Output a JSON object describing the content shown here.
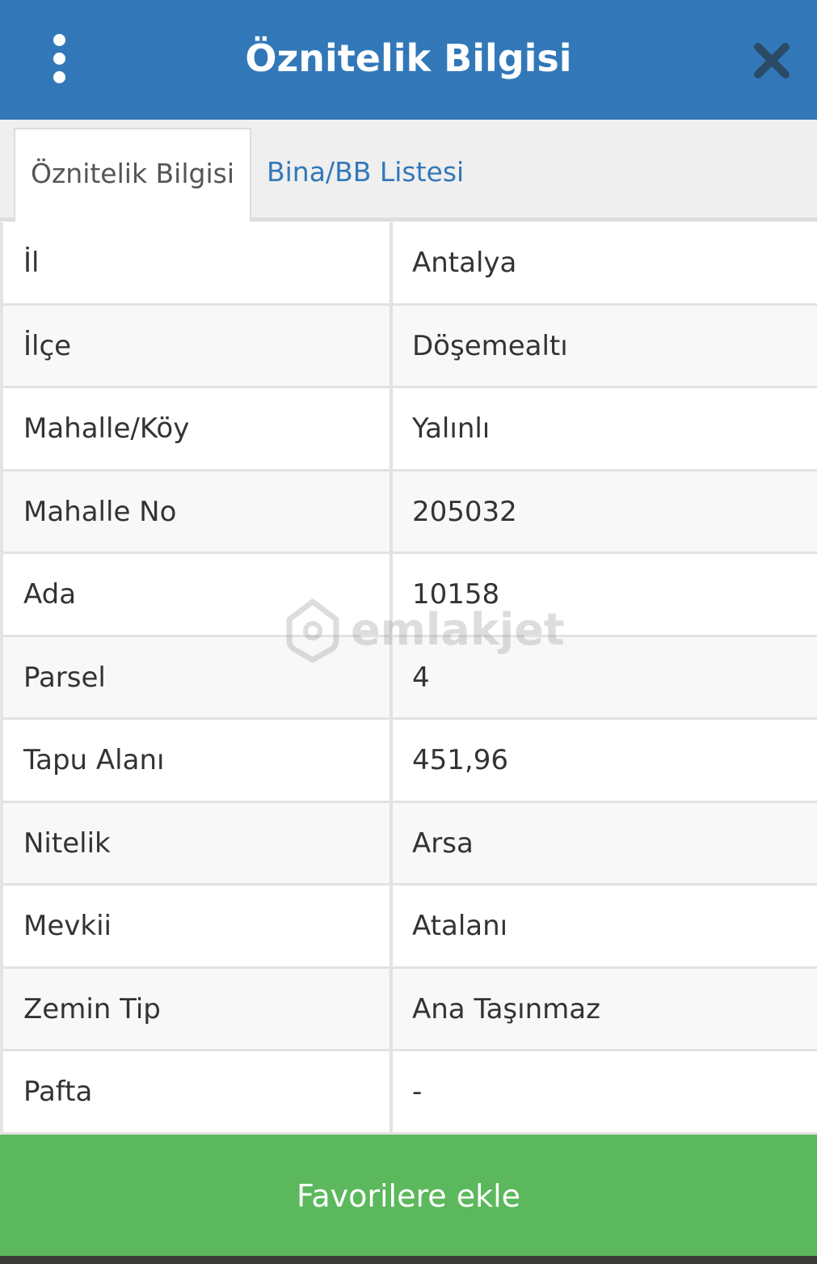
{
  "header": {
    "title": "Öznitelik Bilgisi"
  },
  "tabs": [
    {
      "label": "Öznitelik Bilgisi",
      "active": true
    },
    {
      "label": "Bina/BB Listesi",
      "active": false
    }
  ],
  "attributes": [
    {
      "label": "İl",
      "value": "Antalya"
    },
    {
      "label": "İlçe",
      "value": "Döşemealtı"
    },
    {
      "label": "Mahalle/Köy",
      "value": "Yalınlı"
    },
    {
      "label": "Mahalle No",
      "value": "205032"
    },
    {
      "label": "Ada",
      "value": "10158"
    },
    {
      "label": "Parsel",
      "value": "4"
    },
    {
      "label": "Tapu Alanı",
      "value": "451,96"
    },
    {
      "label": "Nitelik",
      "value": "Arsa"
    },
    {
      "label": "Mevkii",
      "value": "Atalanı"
    },
    {
      "label": "Zemin Tip",
      "value": "Ana Taşınmaz"
    },
    {
      "label": "Pafta",
      "value": "-"
    }
  ],
  "watermark": {
    "text": "emlakjet"
  },
  "footer": {
    "favorite_label": "Favorilere ekle"
  },
  "colors": {
    "header": "#3278b9",
    "tab_link": "#3278b9",
    "favorite_button": "#5cb85c"
  },
  "icons": {
    "menu": "kebab-menu-icon",
    "close": "close-icon",
    "watermark_logo": "house-pin-icon"
  }
}
